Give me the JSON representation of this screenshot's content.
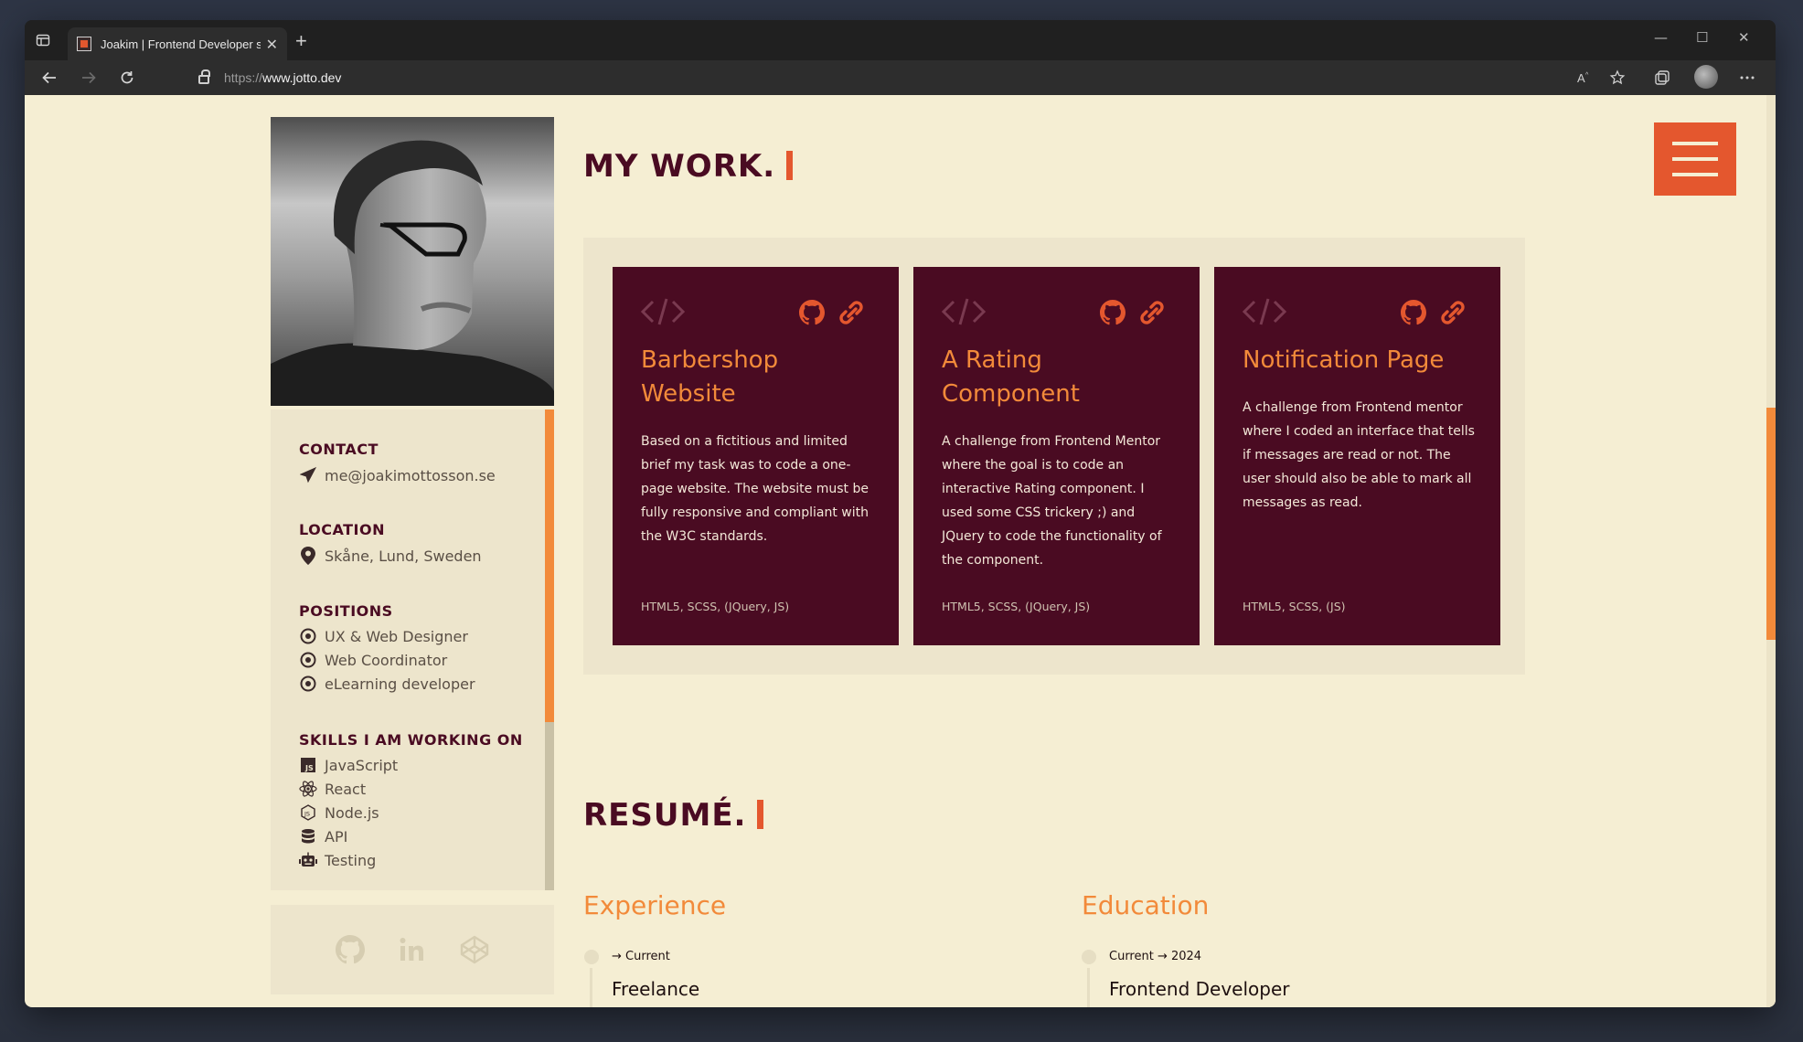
{
  "browser": {
    "tab_title": "Joakim | Frontend Developer stu",
    "tab_close": "✕",
    "new_tab": "+",
    "url_prefix": "https://",
    "url_host": "www.jotto.dev",
    "window_controls": [
      "—",
      "☐",
      "✕"
    ],
    "nav_icons": [
      "back-arrow-icon",
      "forward-arrow-icon",
      "refresh-icon",
      "lock-icon"
    ],
    "tool_icons": [
      "read-aloud-icon",
      "favorite-star-icon",
      "collections-icon",
      "profile-avatar",
      "more-icon"
    ]
  },
  "sidebar": {
    "contact_heading": "CONTACT",
    "contact_email": "me@joakimottosson.se",
    "location_heading": "LOCATION",
    "location_text": "Skåne, Lund, Sweden",
    "positions_heading": "POSITIONS",
    "positions": [
      "UX & Web Designer",
      "Web Coordinator",
      "eLearning developer"
    ],
    "skills_heading": "SKILLS I AM WORKING ON",
    "skills": [
      {
        "label": "JavaScript",
        "icon": "js-icon"
      },
      {
        "label": "React",
        "icon": "react-icon"
      },
      {
        "label": "Node.js",
        "icon": "nodejs-icon"
      },
      {
        "label": "API",
        "icon": "database-icon"
      },
      {
        "label": "Testing",
        "icon": "robot-icon"
      }
    ],
    "social_icons": [
      "github-icon",
      "linkedin-icon",
      "codepen-icon"
    ]
  },
  "work": {
    "title": "MY WORK.",
    "cards": [
      {
        "title": "Barbershop Website",
        "description": "Based on a fictitious and limited brief my task was to code a one-page website. The website must be fully responsive and compliant with the W3C standards.",
        "tech": "HTML5, SCSS, (JQuery, JS)"
      },
      {
        "title": "A Rating Component",
        "description": "A challenge from Frontend Mentor where the goal is to code an interactive Rating component. I used some CSS trickery ;) and JQuery to code the functionality of the component.",
        "tech": "HTML5, SCSS, (JQuery, JS)"
      },
      {
        "title": "Notification Page",
        "description": "A challenge from Frontend mentor where I coded an interface that tells if messages are read or not. The user should also be able to mark all messages as read.",
        "tech": "HTML5, SCSS, (JS)"
      }
    ]
  },
  "resume": {
    "title": "RESUMÉ.",
    "experience": {
      "heading": "Experience",
      "date": "→ Current",
      "role": "Freelance"
    },
    "education": {
      "heading": "Education",
      "date": "Current → 2024",
      "role": "Frontend Developer"
    }
  },
  "colors": {
    "page_bg": "#f5eed3",
    "card_bg": "#4a0b22",
    "accent_orange": "#f28a3a",
    "accent_red": "#e4572e"
  }
}
